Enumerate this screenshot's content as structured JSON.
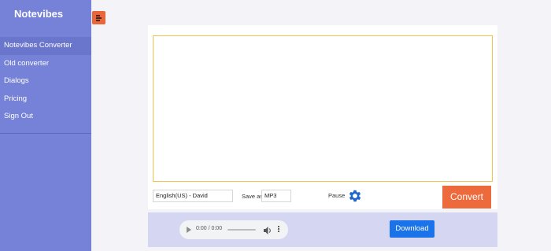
{
  "app": {
    "title": "Notevibes"
  },
  "sidebar": {
    "items": [
      {
        "label": "Notevibes Converter",
        "active": true
      },
      {
        "label": "Old converter"
      },
      {
        "label": "Dialogs"
      },
      {
        "label": "Pricing"
      },
      {
        "label": "Sign Out"
      }
    ]
  },
  "toolbar": {
    "menu_icon": "menu-icon"
  },
  "editor": {
    "text": "",
    "voice": "English(US) - David",
    "save_as_label": "Save as",
    "format": "MP3",
    "pause_label": "Pause",
    "settings_icon": "gear-icon",
    "convert_label": "Convert"
  },
  "player": {
    "time": "0:00 / 0:00",
    "download_label": "Download"
  },
  "colors": {
    "sidebar": "#7582d8",
    "accent": "#ec6a3c",
    "download": "#1a73e8",
    "textarea_border": "#f0c14b"
  }
}
